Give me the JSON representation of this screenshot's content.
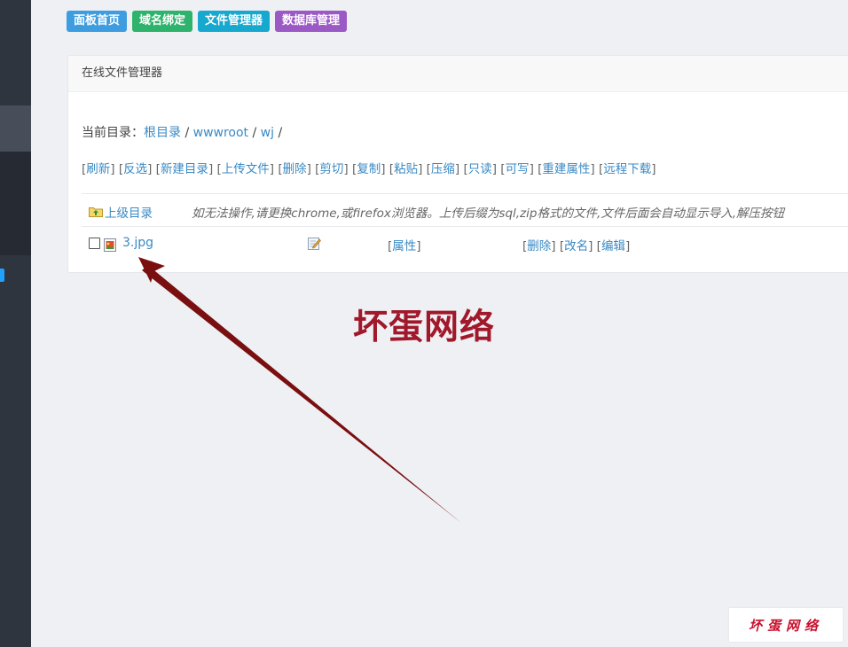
{
  "colors": {
    "nav_home": "#3d9de0",
    "nav_domain": "#2db36b",
    "nav_files": "#17a8cf",
    "nav_db": "#9b59c6",
    "link": "#3a8ac4",
    "watermark": "#a0182a",
    "arrow": "#7a0f10"
  },
  "topnav": {
    "home": "面板首页",
    "domain": "域名绑定",
    "files": "文件管理器",
    "database": "数据库管理"
  },
  "panel": {
    "title": "在线文件管理器",
    "path": {
      "label": "当前目录：",
      "root": "根目录",
      "sep": "/",
      "seg1": "wwwroot",
      "seg2": "wj"
    },
    "actions": [
      "刷新",
      "反选",
      "新建目录",
      "上传文件",
      "删除",
      "剪切",
      "复制",
      "粘贴",
      "压缩",
      "只读",
      "可写",
      "重建属性",
      "远程下载"
    ],
    "parent_dir": {
      "icon": "folder-up-icon",
      "label": "上级目录",
      "notice": "如无法操作,请更换chrome,或firefox浏览器。上传后缀为sql,zip格式的文件,文件后面会自动显示导入,解压按钮"
    },
    "file": {
      "checked": false,
      "icon": "image-file-icon",
      "name": "3.jpg",
      "edit_icon": "edit-icon",
      "attr_label": "属性",
      "delete_label": "删除",
      "rename_label": "改名",
      "edit_label": "编辑"
    }
  },
  "watermark": {
    "big": "坏蛋网络",
    "small": "坏蛋网络"
  }
}
